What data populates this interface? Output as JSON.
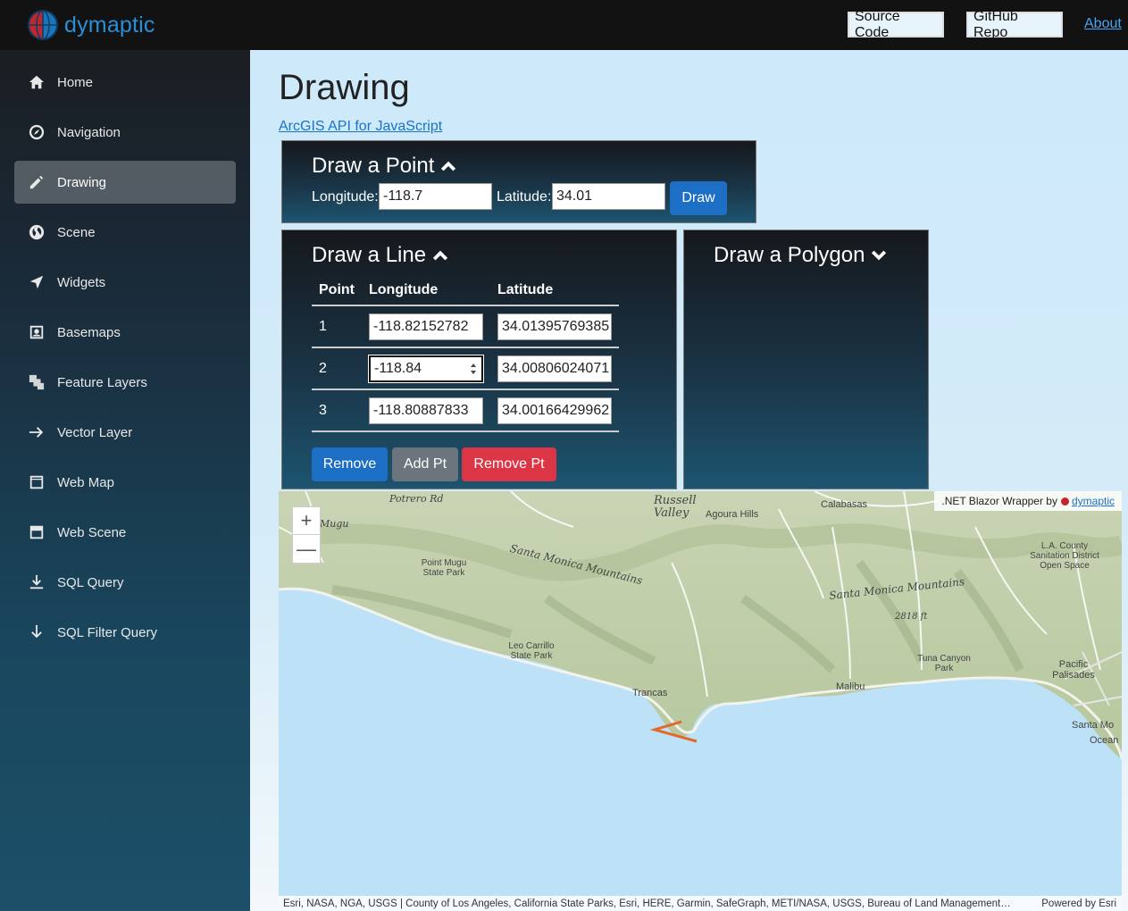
{
  "brand": {
    "name": "dymaptic"
  },
  "topbar": {
    "source_code": "Source Code",
    "github_repo": "GitHub Repo",
    "about": "About"
  },
  "sidebar": {
    "items": [
      {
        "label": "Home",
        "icon": "home-icon"
      },
      {
        "label": "Navigation",
        "icon": "compass-icon"
      },
      {
        "label": "Drawing",
        "icon": "pencil-icon",
        "active": true
      },
      {
        "label": "Scene",
        "icon": "globe-icon"
      },
      {
        "label": "Widgets",
        "icon": "location-arrow-icon"
      },
      {
        "label": "Basemaps",
        "icon": "map-image-icon"
      },
      {
        "label": "Feature Layers",
        "icon": "layers-icon"
      },
      {
        "label": "Vector Layer",
        "icon": "arrow-right-icon"
      },
      {
        "label": "Web Map",
        "icon": "browser-window-icon"
      },
      {
        "label": "Web Scene",
        "icon": "window-icon"
      },
      {
        "label": "SQL Query",
        "icon": "download-icon"
      },
      {
        "label": "SQL Filter Query",
        "icon": "arrow-down-icon"
      }
    ]
  },
  "page": {
    "title": "Drawing",
    "api_link": "ArcGIS API for JavaScript"
  },
  "point_panel": {
    "title": "Draw a Point",
    "longitude_label": "Longitude:",
    "longitude_value": "-118.7",
    "latitude_label": "Latitude:",
    "latitude_value": "34.01",
    "draw_button": "Draw"
  },
  "line_panel": {
    "title": "Draw a Line",
    "columns": [
      "Point",
      "Longitude",
      "Latitude"
    ],
    "rows": [
      {
        "point": "1",
        "longitude": "-118.82152782",
        "latitude": "34.01395769385"
      },
      {
        "point": "2",
        "longitude": "-118.84",
        "latitude": "34.00806024071"
      },
      {
        "point": "3",
        "longitude": "-118.80887833",
        "latitude": "34.00166429962"
      }
    ],
    "remove_button": "Remove",
    "add_pt_button": "Add Pt",
    "remove_pt_button": "Remove Pt"
  },
  "polygon_panel": {
    "title": "Draw a Polygon"
  },
  "map": {
    "zoom_in": "+",
    "zoom_out": "—",
    "wrapper_text": ".NET Blazor Wrapper by",
    "wrapper_link": "dymaptic",
    "attribution": "Esri, NASA, NGA, USGS | County of Los Angeles, California State Parks, Esri, HERE, Garmin, SafeGraph, METI/NASA, USGS, Bureau of Land Management…",
    "powered_by": "Powered by Esri",
    "labels": {
      "russell_valley": "Russell Valley",
      "agoura_hills": "Agoura Hills",
      "calabasas": "Calabasas",
      "point_mugu": "Point Mugu State Park",
      "santa_monica_mtns_1": "Santa Monica Mountains",
      "santa_monica_mtns_2": "Santa Monica Mountains",
      "la_county": "L.A. County Sanitation District Open Space",
      "elevation": "2818 ft",
      "leo_carrillo": "Leo Carrillo State Park",
      "tuna_canyon": "Tuna Canyon Park",
      "trancas": "Trancas",
      "malibu": "Malibu",
      "pacific_palisades": "Pacific Palisades",
      "santa_monica": "Santa Mo",
      "ocean": "Ocean",
      "mugu": "Mugu",
      "potrero": "Potrero Rd"
    },
    "line_color": "#e2692a"
  }
}
